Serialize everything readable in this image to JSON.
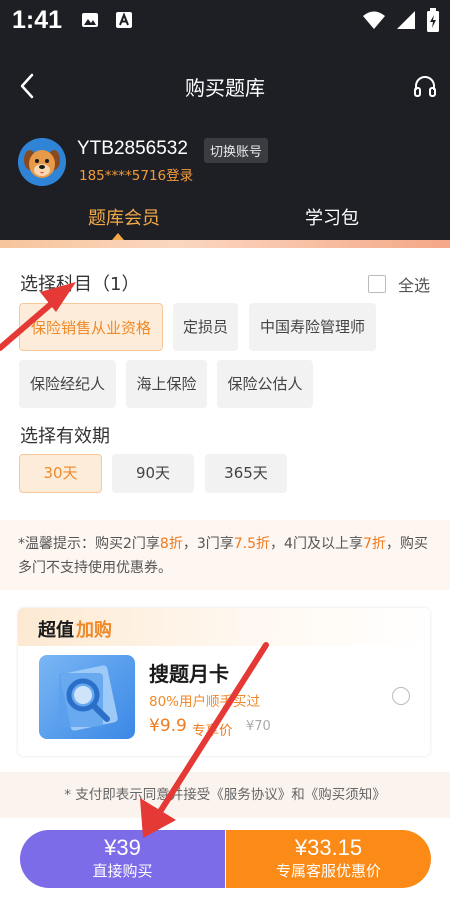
{
  "status_bar": {
    "time": "1:41"
  },
  "nav": {
    "title": "购买题库"
  },
  "account": {
    "user_id": "YTB2856532",
    "switch_label": "切换账号",
    "phone_login": "185****5716登录"
  },
  "tabs": [
    {
      "label": "题库会员",
      "active": true
    },
    {
      "label": "学习包",
      "active": false
    }
  ],
  "subjects": {
    "title": "选择科目（1）",
    "select_all": "全选",
    "items": [
      {
        "label": "保险销售从业资格",
        "selected": true
      },
      {
        "label": "定损员",
        "selected": false
      },
      {
        "label": "中国寿险管理师",
        "selected": false
      },
      {
        "label": "保险经纪人",
        "selected": false
      },
      {
        "label": "海上保险",
        "selected": false
      },
      {
        "label": "保险公估人",
        "selected": false
      }
    ]
  },
  "validity": {
    "title": "选择有效期",
    "items": [
      {
        "label": "30天",
        "selected": true
      },
      {
        "label": "90天",
        "selected": false
      },
      {
        "label": "365天",
        "selected": false
      }
    ]
  },
  "tip": {
    "prefix": "*温馨提示：购买2门享",
    "d1": "8折",
    "mid1": "，3门享",
    "d2": "7.5折",
    "mid2": "，4门及以上享",
    "d3": "7折",
    "suffix": "，购买多门不支持使用优惠券。"
  },
  "addon": {
    "header_part1": "超值",
    "header_part2": "加购",
    "name": "搜题月卡",
    "subtitle": "80%用户顺手买过",
    "price": "¥9.9",
    "price_label": "专享价",
    "original_price": "¥70"
  },
  "agreement": "* 支付即表示同意并接受《服务协议》和《购买须知》",
  "buttons": {
    "buy_price": "¥39",
    "buy_label": "直接购买",
    "cs_price": "¥33.15",
    "cs_label": "专属客服优惠价"
  },
  "colors": {
    "accent_orange": "#fb8a17",
    "purple": "#7c6ce8",
    "dark_bg": "#1d1f24",
    "arrow_red": "#e53935"
  }
}
